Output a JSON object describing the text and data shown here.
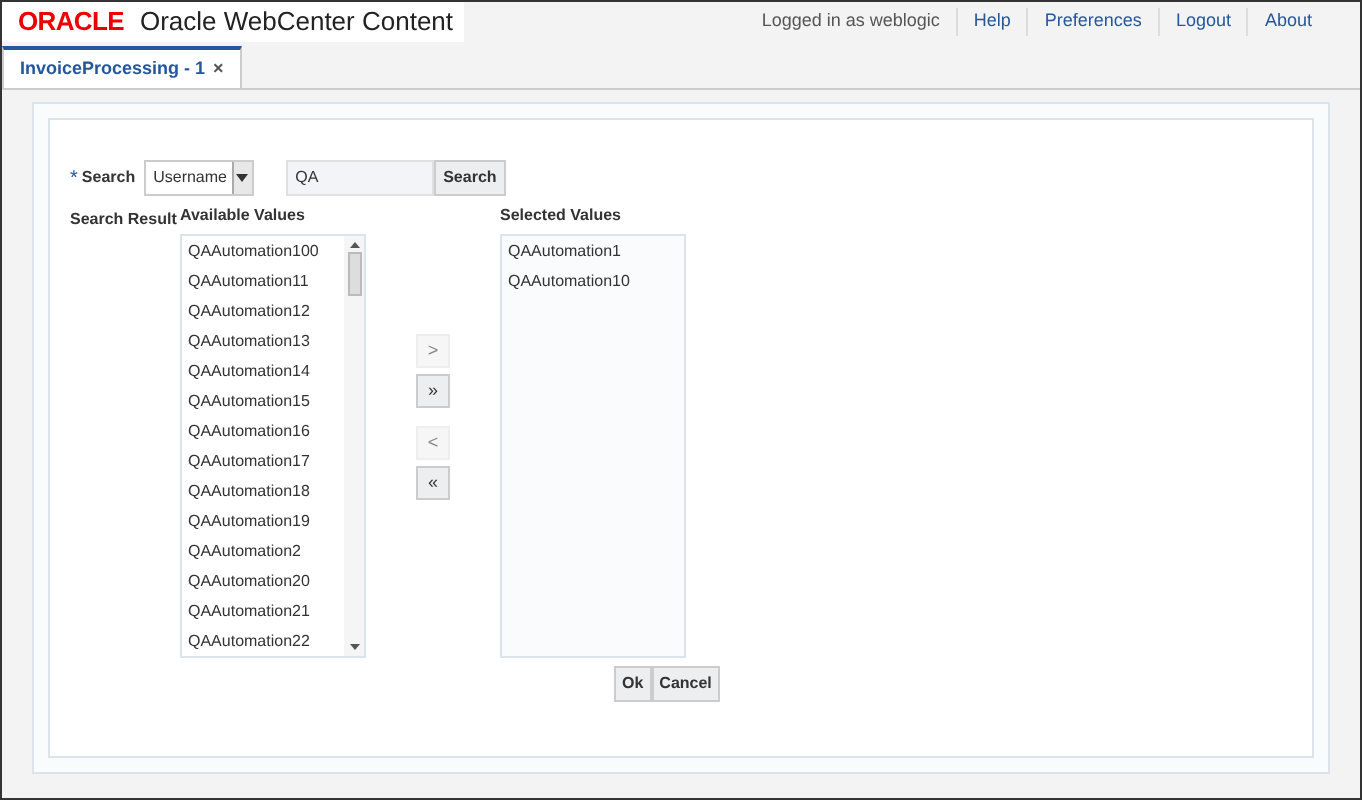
{
  "header": {
    "logo": "ORACLE",
    "product": "Oracle WebCenter Content",
    "user": "Logged in as weblogic",
    "links": [
      "Help",
      "Preferences",
      "Logout",
      "About"
    ]
  },
  "tabs": [
    {
      "label": "InvoiceProcessing - 1",
      "selected": true,
      "close": "×"
    }
  ],
  "search": {
    "required_mark": "*",
    "label": "Search",
    "field_value": "Username",
    "query": "QA",
    "button": "Search"
  },
  "result_label": "Search Result",
  "available": {
    "heading": "Available Values",
    "items": [
      "QAAutomation100",
      "QAAutomation11",
      "QAAutomation12",
      "QAAutomation13",
      "QAAutomation14",
      "QAAutomation15",
      "QAAutomation16",
      "QAAutomation17",
      "QAAutomation18",
      "QAAutomation19",
      "QAAutomation2",
      "QAAutomation20",
      "QAAutomation21",
      "QAAutomation22"
    ]
  },
  "shuttle": [
    {
      "label": ">",
      "disabled": true
    },
    {
      "label": "»",
      "disabled": false
    },
    {
      "label": "<",
      "disabled": true
    },
    {
      "label": "«",
      "disabled": false
    }
  ],
  "selected": {
    "heading": "Selected Values",
    "items": [
      "QAAutomation1",
      "QAAutomation10"
    ]
  },
  "buttons": [
    "Ok",
    "Cancel"
  ]
}
